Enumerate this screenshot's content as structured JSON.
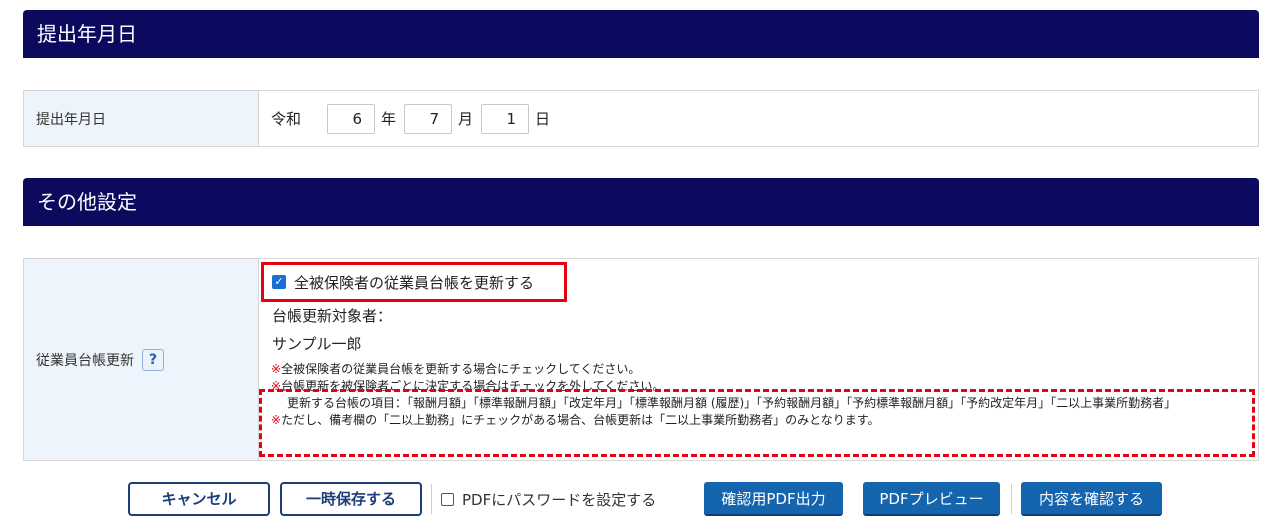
{
  "section_submission": {
    "title": "提出年月日",
    "row_label": "提出年月日",
    "era": "令和",
    "year": "6",
    "year_unit": "年",
    "month": "7",
    "month_unit": "月",
    "day": "1",
    "day_unit": "日"
  },
  "section_other": {
    "title": "その他設定",
    "row_label": "従業員台帳更新",
    "help_label": "?",
    "update_all_label": "全被保険者の従業員台帳を更新する",
    "update_all_checked": true,
    "target_label": "台帳更新対象者：",
    "target_name": "サンプル一郎",
    "note_mark": "※",
    "notes": [
      "全被保険者の従業員台帳を更新する場合にチェックしてください。",
      "台帳更新を被保険者ごとに決定する場合はチェックを外してください。",
      "更新する台帳の項目：「報酬月額」「標準報酬月額」「改定年月」「標準報酬月額 (履歴)」「予約報酬月額」「予約標準報酬月額」「予約改定年月」「二以上事業所勤務者」",
      "ただし、備考欄の「二以上勤務」にチェックがある場合、台帳更新は「二以上事業所勤務者」のみとなります。"
    ]
  },
  "actions": {
    "cancel": "キャンセル",
    "save_temp": "一時保存する",
    "pdf_password": "PDFにパスワードを設定する",
    "pdf_output": "確認用PDF出力",
    "pdf_preview": "PDFプレビュー",
    "confirm": "内容を確認する"
  },
  "colors": {
    "header_bg": "#0b0a5e",
    "label_bg": "#eef4fb",
    "highlight": "#e50012",
    "primary_button": "#1565ae"
  }
}
